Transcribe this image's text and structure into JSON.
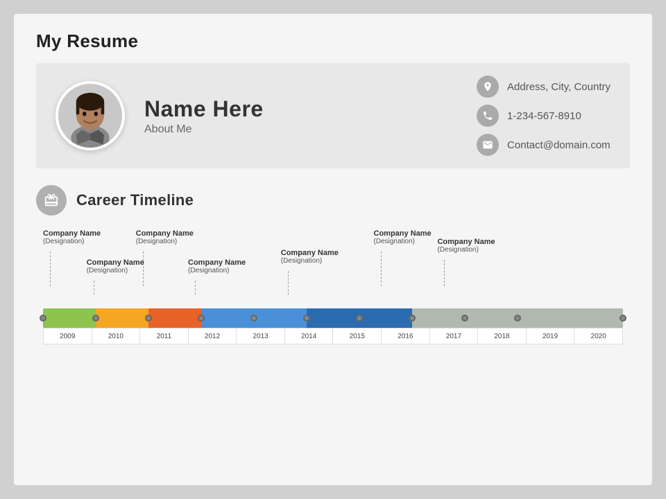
{
  "slide": {
    "title": "My Resume",
    "header": {
      "name": "Name Here",
      "about": "About Me",
      "contacts": [
        {
          "icon": "📍",
          "label": "Address, City, Country",
          "type": "address"
        },
        {
          "icon": "📞",
          "label": "1-234-567-8910",
          "type": "phone"
        },
        {
          "icon": "✉",
          "label": "Contact@domain.com",
          "type": "email"
        }
      ]
    },
    "career": {
      "section_title": "Career Timeline",
      "labels_top": [
        {
          "company": "Company Name",
          "designation": "(Designation)",
          "position": 0.0,
          "side": "top"
        },
        {
          "company": "Company Name",
          "designation": "(Designation)",
          "position": 9.1,
          "side": "bottom"
        },
        {
          "company": "Company Name",
          "designation": "(Designation)",
          "position": 18.2,
          "side": "top"
        },
        {
          "company": "Company Name",
          "designation": "(Designation)",
          "position": 27.3,
          "side": "bottom"
        },
        {
          "company": "Company Name",
          "designation": "(Designation)",
          "position": 45.5,
          "side": "bottom"
        },
        {
          "company": "Company Name",
          "designation": "(Designation)",
          "position": 63.6,
          "side": "top"
        },
        {
          "company": "Company Name",
          "designation": "(Designation)",
          "position": 72.7,
          "side": "top"
        }
      ],
      "bars": [
        {
          "start": 0,
          "end": 9.1,
          "color": "#8dc44e",
          "label": "2009-2010"
        },
        {
          "start": 9.1,
          "end": 18.2,
          "color": "#f5a623",
          "label": "2010-2011"
        },
        {
          "start": 18.2,
          "end": 27.3,
          "color": "#e86328",
          "label": "2011-2012"
        },
        {
          "start": 27.3,
          "end": 45.5,
          "color": "#4a90d9",
          "label": "2012-2014"
        },
        {
          "start": 45.5,
          "end": 63.6,
          "color": "#2b6cb0",
          "label": "2014-2017"
        },
        {
          "start": 63.6,
          "end": 100,
          "color": "#b0b8b0",
          "label": "2017-2020"
        }
      ],
      "years": [
        "2009",
        "2010",
        "2011",
        "2012",
        "2013",
        "2014",
        "2015",
        "2016",
        "2017",
        "2018",
        "2019",
        "2020"
      ],
      "dot_positions": [
        0,
        9.1,
        18.2,
        27.3,
        45.5,
        54.6,
        63.6,
        72.7,
        81.8,
        90.9
      ]
    }
  }
}
